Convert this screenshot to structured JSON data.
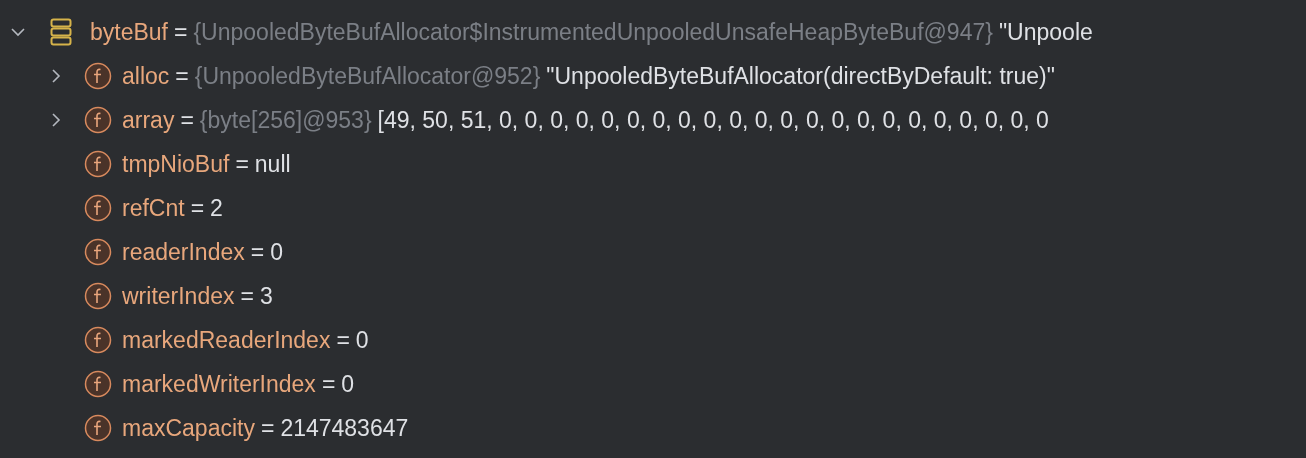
{
  "variable": {
    "name": "byteBuf",
    "sep": "=",
    "type": "{UnpooledByteBufAllocator$InstrumentedUnpooledUnsafeHeapByteBuf@947}",
    "value": "\"Unpoole",
    "expanded": true,
    "children": [
      {
        "kind": "object",
        "expanded": false,
        "name": "alloc",
        "sep": "=",
        "type": "{UnpooledByteBufAllocator@952}",
        "value": "\"UnpooledByteBufAllocator(directByDefault: true)\""
      },
      {
        "kind": "object",
        "expanded": false,
        "name": "array",
        "sep": "=",
        "type": "{byte[256]@953}",
        "value": "[49, 50, 51, 0, 0, 0, 0, 0, 0, 0, 0, 0, 0, 0, 0, 0, 0, 0, 0, 0, 0, 0, 0, 0, 0"
      },
      {
        "kind": "primitive",
        "name": "tmpNioBuf",
        "sep": "=",
        "value": "null"
      },
      {
        "kind": "primitive",
        "name": "refCnt",
        "sep": "=",
        "value": "2"
      },
      {
        "kind": "primitive",
        "name": "readerIndex",
        "sep": "=",
        "value": "0"
      },
      {
        "kind": "primitive",
        "name": "writerIndex",
        "sep": "=",
        "value": "3"
      },
      {
        "kind": "primitive",
        "name": "markedReaderIndex",
        "sep": "=",
        "value": "0"
      },
      {
        "kind": "primitive",
        "name": "markedWriterIndex",
        "sep": "=",
        "value": "0"
      },
      {
        "kind": "primitive",
        "name": "maxCapacity",
        "sep": "=",
        "value": "2147483647"
      }
    ]
  }
}
